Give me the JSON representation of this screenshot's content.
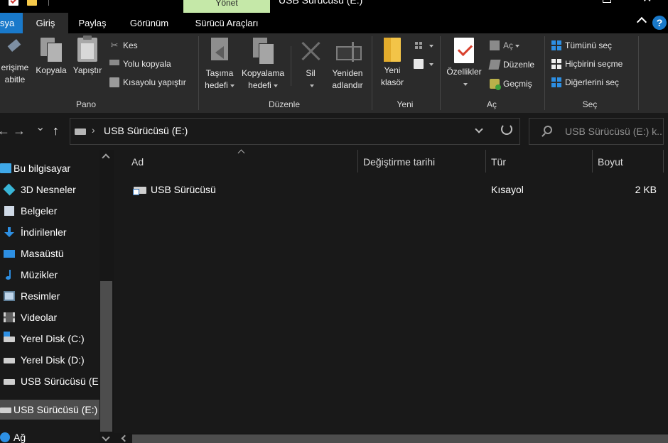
{
  "window": {
    "title": "USB Sürücüsü (E:)",
    "context_tab": "Yönet",
    "close_glyph": "✕"
  },
  "tabs": {
    "file": "sya",
    "home": "Giriş",
    "share": "Paylaş",
    "view": "Görünüm",
    "drive_tools": "Sürücü Araçları",
    "help": "?"
  },
  "ribbon": {
    "clipboard": {
      "group_label": "Pano",
      "pin_line1": "erişime",
      "pin_line2": "abitle",
      "copy": "Kopyala",
      "paste": "Yapıştır",
      "cut": "Kes",
      "copy_path": "Yolu kopyala",
      "paste_shortcut": "Kısayolu yapıştır"
    },
    "organize": {
      "group_label": "Düzenle",
      "move_line1": "Taşıma",
      "move_line2": "hedefi",
      "copy_to_line1": "Kopyalama",
      "copy_to_line2": "hedefi",
      "delete": "Sil",
      "rename_line1": "Yeniden",
      "rename_line2": "adlandır"
    },
    "new": {
      "group_label": "Yeni",
      "new_folder_line1": "Yeni",
      "new_folder_line2": "klasör"
    },
    "open": {
      "group_label": "Aç",
      "properties": "Özellikler",
      "open": "Aç",
      "edit": "Düzenle",
      "history": "Geçmiş"
    },
    "select": {
      "group_label": "Seç",
      "select_all": "Tümünü seç",
      "select_none": "Hiçbirini seçme",
      "invert": "Diğerlerini seç"
    }
  },
  "address": {
    "path": "USB Sürücüsü (E:)",
    "separator": "›",
    "search_placeholder": "USB Sürücüsü (E:) k..."
  },
  "nav": {
    "back": "←",
    "forward": "→",
    "recent": "⌄",
    "up": "↑"
  },
  "sidebar": {
    "items": [
      {
        "label": "Bu bilgisayar",
        "icon": "computer-icon"
      },
      {
        "label": "3D Nesneler",
        "icon": "3d-objects-icon"
      },
      {
        "label": "Belgeler",
        "icon": "documents-icon"
      },
      {
        "label": "İndirilenler",
        "icon": "downloads-icon"
      },
      {
        "label": "Masaüstü",
        "icon": "desktop-icon"
      },
      {
        "label": "Müzikler",
        "icon": "music-icon"
      },
      {
        "label": "Resimler",
        "icon": "pictures-icon"
      },
      {
        "label": "Videolar",
        "icon": "videos-icon"
      },
      {
        "label": "Yerel Disk (C:)",
        "icon": "windows-disk-icon"
      },
      {
        "label": "Yerel Disk (D:)",
        "icon": "disk-icon"
      },
      {
        "label": "USB Sürücüsü (E:",
        "icon": "usb-drive-icon"
      },
      {
        "label": "USB Sürücüsü (E:)",
        "icon": "usb-drive-icon",
        "selected": true
      },
      {
        "label": "Ağ",
        "icon": "network-icon"
      }
    ]
  },
  "filelist": {
    "columns": [
      "Ad",
      "Değiştirme tarihi",
      "Tür",
      "Boyut"
    ],
    "rows": [
      {
        "name": "USB Sürücüsü",
        "modified": "",
        "type": "Kısayol",
        "size": "2 KB"
      }
    ]
  },
  "colors": {
    "background": "#191919",
    "ribbon": "#2b2b2b",
    "file_tab": "#1979ca",
    "context_tab": "#c5e8a8",
    "selection": "#4d4d4d",
    "accent_blue": "#2d8fe3"
  }
}
